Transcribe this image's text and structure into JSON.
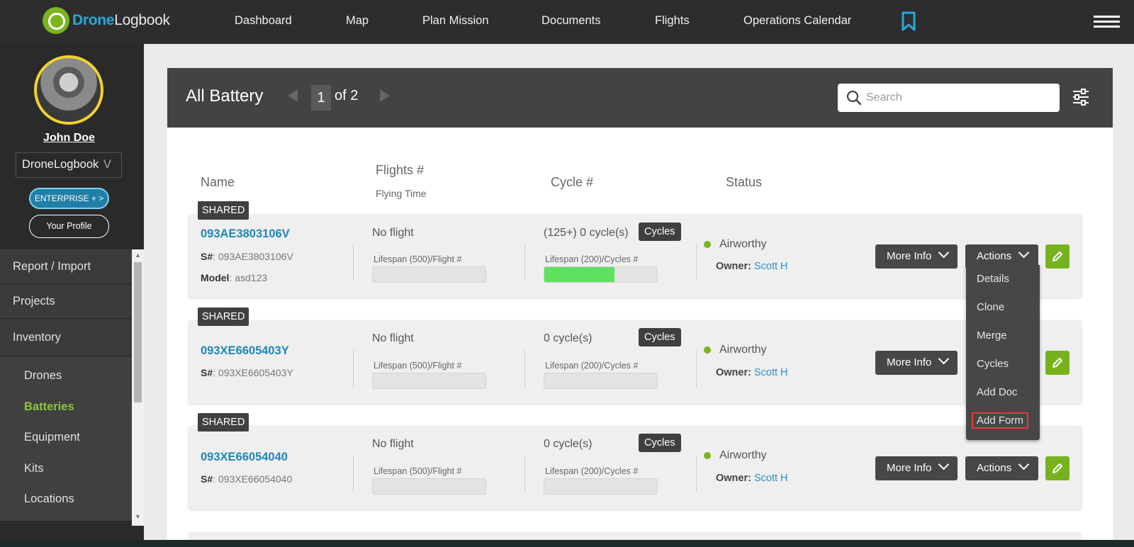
{
  "brand": {
    "name_a": "Drone",
    "name_b": "Logbook"
  },
  "nav": [
    "Dashboard",
    "Map",
    "Plan Mission",
    "Documents",
    "Flights",
    "Operations Calendar"
  ],
  "colors": {
    "accent": "#29a8dc",
    "green": "#76b21e",
    "dark": "#2d2d2d",
    "panel": "#434343",
    "link": "#2c8fc9"
  },
  "icons": [
    "bookmark-icon",
    "hamburger-menu-icon",
    "search-icon",
    "filter-sliders-icon",
    "pencil-icon",
    "chevron-down-icon"
  ],
  "sidebar": {
    "user": "John Doe",
    "org": "DroneLogbook",
    "org_chev": "V",
    "enterprise": "ENTERPRISE + >",
    "profile": "Your Profile",
    "menu": [
      "Report / Import",
      "Projects",
      "Inventory"
    ],
    "submenu": [
      "Drones",
      "Batteries",
      "Equipment",
      "Kits",
      "Locations"
    ],
    "active": "Batteries"
  },
  "panel": {
    "title": "All Battery",
    "page": "1",
    "of": "of 2",
    "search_placeholder": "Search"
  },
  "columns": {
    "name": "Name",
    "flights": "Flights #",
    "flying_time": "Flying Time",
    "cycle": "Cycle #",
    "status": "Status"
  },
  "rows": [
    {
      "badge": "SHARED",
      "sn": "093AE3803106V",
      "serial_label": "S#",
      "serial": ": 093AE3803106V",
      "model_label": "Model",
      "model": ": asd123",
      "flight": "No flight",
      "flight_life": "Lifespan (500)/Flight #",
      "cycles": "(125+) 0 cycle(s)",
      "cycle_life": "Lifespan (200)/Cycles #",
      "cycle_fill": 0.62,
      "cycles_btn": "Cycles",
      "status": "Airworthy",
      "owner_label": "Owner:",
      "owner": "Scott H",
      "more": "More Info",
      "actions": "Actions"
    },
    {
      "badge": "SHARED",
      "sn": "093XE6605403Y",
      "serial_label": "S#",
      "serial": ": 093XE6605403Y",
      "flight": "No flight",
      "flight_life": "Lifespan (500)/Flight #",
      "cycles": "0 cycle(s)",
      "cycle_life": "Lifespan (200)/Cycles #",
      "cycle_fill": 0,
      "cycles_btn": "Cycles",
      "status": "Airworthy",
      "owner_label": "Owner:",
      "owner": "Scott H",
      "more": "More Info"
    },
    {
      "badge": "SHARED",
      "sn": "093XE66054040",
      "serial_label": "S#",
      "serial": ": 093XE66054040",
      "flight": "No flight",
      "flight_life": "Lifespan (500)/Flight #",
      "cycles": "0 cycle(s)",
      "cycle_life": "Lifespan (200)/Cycles #",
      "cycle_fill": 0,
      "cycles_btn": "Cycles",
      "status": "Airworthy",
      "owner_label": "Owner:",
      "owner": "Scott H",
      "more": "More Info",
      "actions": "Actions"
    }
  ],
  "dropdown": [
    "Details",
    "Clone",
    "Merge",
    "Cycles",
    "Add Doc",
    "Add Form"
  ]
}
